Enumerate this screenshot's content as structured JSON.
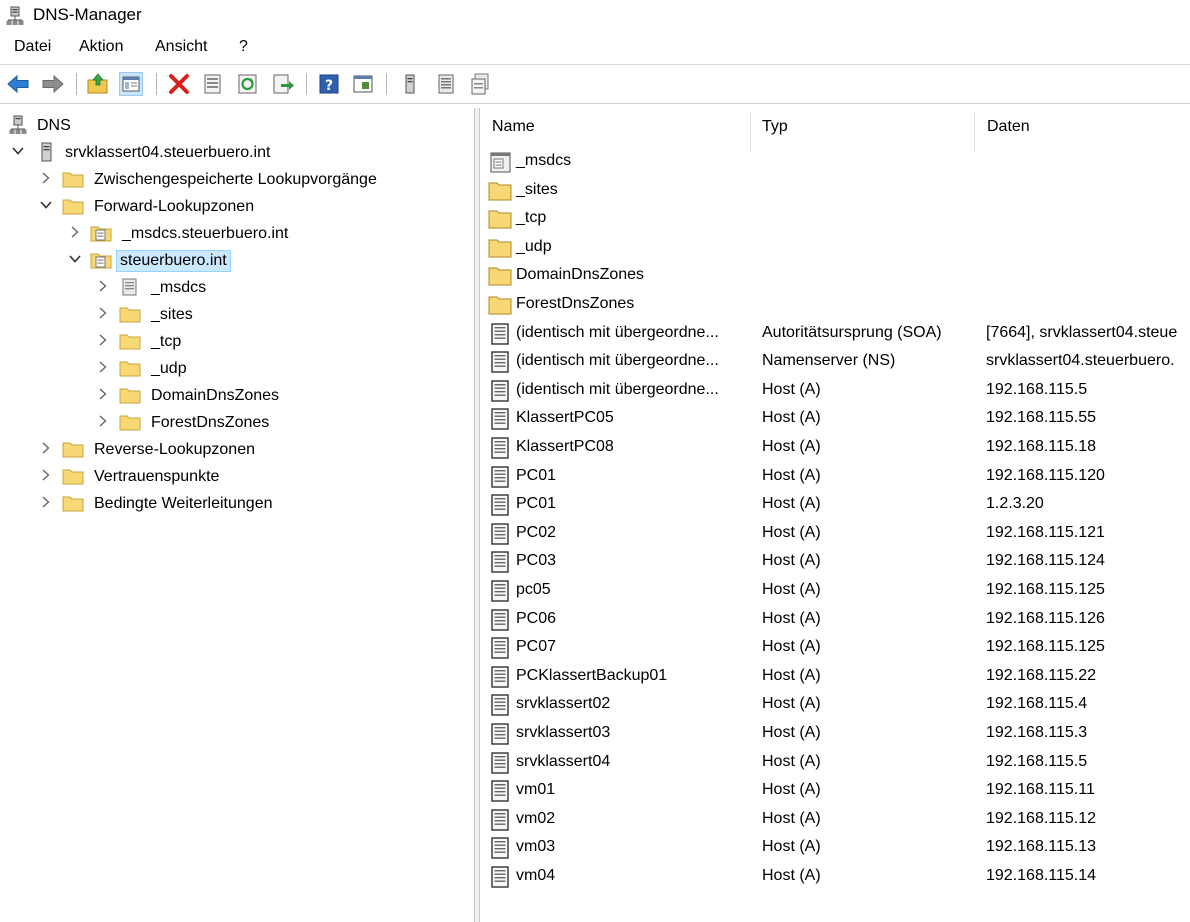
{
  "window": {
    "title": "DNS-Manager"
  },
  "menu": [
    "Datei",
    "Aktion",
    "Ansicht",
    "?"
  ],
  "toolbar": [
    "back-icon",
    "forward-icon",
    "up-folder-icon",
    "show-hide-tree-icon",
    "delete-icon",
    "properties-icon",
    "refresh-icon",
    "export-icon",
    "help-icon",
    "console-icon",
    "server-icon",
    "zone-icon",
    "zone-settings-icon"
  ],
  "tree": {
    "root": "DNS",
    "server": "srvklassert04.steuerbuero.int",
    "items": [
      "Zwischengespeicherte Lookupvorgänge",
      "Forward-Lookupzonen",
      "_msdcs.steuerbuero.int",
      "steuerbuero.int",
      "_msdcs",
      "_sites",
      "_tcp",
      "_udp",
      "DomainDnsZones",
      "ForestDnsZones",
      "Reverse-Lookupzonen",
      "Vertrauenspunkte",
      "Bedingte Weiterleitungen"
    ]
  },
  "list": {
    "columns": [
      "Name",
      "Typ",
      "Daten"
    ],
    "rows": [
      {
        "name": "_msdcs",
        "type": "",
        "data": "",
        "icon": "zone-icon"
      },
      {
        "name": "_sites",
        "type": "",
        "data": "",
        "icon": "folder-icon"
      },
      {
        "name": "_tcp",
        "type": "",
        "data": "",
        "icon": "folder-icon"
      },
      {
        "name": "_udp",
        "type": "",
        "data": "",
        "icon": "folder-icon"
      },
      {
        "name": "DomainDnsZones",
        "type": "",
        "data": "",
        "icon": "folder-icon"
      },
      {
        "name": "ForestDnsZones",
        "type": "",
        "data": "",
        "icon": "folder-icon"
      },
      {
        "name": "(identisch mit übergeordne...",
        "type": "Autoritätsursprung (SOA)",
        "data": "[7664], srvklassert04.steue",
        "icon": "record-icon"
      },
      {
        "name": "(identisch mit übergeordne...",
        "type": "Namenserver (NS)",
        "data": "srvklassert04.steuerbuero.",
        "icon": "record-icon"
      },
      {
        "name": "(identisch mit übergeordne...",
        "type": "Host (A)",
        "data": "192.168.115.5",
        "icon": "record-icon"
      },
      {
        "name": "KlassertPC05",
        "type": "Host (A)",
        "data": "192.168.115.55",
        "icon": "record-icon"
      },
      {
        "name": "KlassertPC08",
        "type": "Host (A)",
        "data": "192.168.115.18",
        "icon": "record-icon"
      },
      {
        "name": "PC01",
        "type": "Host (A)",
        "data": "192.168.115.120",
        "icon": "record-icon"
      },
      {
        "name": "PC01",
        "type": "Host (A)",
        "data": "1.2.3.20",
        "icon": "record-icon"
      },
      {
        "name": "PC02",
        "type": "Host (A)",
        "data": "192.168.115.121",
        "icon": "record-icon"
      },
      {
        "name": "PC03",
        "type": "Host (A)",
        "data": "192.168.115.124",
        "icon": "record-icon"
      },
      {
        "name": "pc05",
        "type": "Host (A)",
        "data": "192.168.115.125",
        "icon": "record-icon"
      },
      {
        "name": "PC06",
        "type": "Host (A)",
        "data": "192.168.115.126",
        "icon": "record-icon"
      },
      {
        "name": "PC07",
        "type": "Host (A)",
        "data": "192.168.115.125",
        "icon": "record-icon"
      },
      {
        "name": "PCKlassertBackup01",
        "type": "Host (A)",
        "data": "192.168.115.22",
        "icon": "record-icon"
      },
      {
        "name": "srvklassert02",
        "type": "Host (A)",
        "data": "192.168.115.4",
        "icon": "record-icon"
      },
      {
        "name": "srvklassert03",
        "type": "Host (A)",
        "data": "192.168.115.3",
        "icon": "record-icon"
      },
      {
        "name": "srvklassert04",
        "type": "Host (A)",
        "data": "192.168.115.5",
        "icon": "record-icon"
      },
      {
        "name": "vm01",
        "type": "Host (A)",
        "data": "192.168.115.11",
        "icon": "record-icon"
      },
      {
        "name": "vm02",
        "type": "Host (A)",
        "data": "192.168.115.12",
        "icon": "record-icon"
      },
      {
        "name": "vm03",
        "type": "Host (A)",
        "data": "192.168.115.13",
        "icon": "record-icon"
      },
      {
        "name": "vm04",
        "type": "Host (A)",
        "data": "192.168.115.14",
        "icon": "record-icon"
      }
    ]
  },
  "colors": {
    "selection": "#cce8ff",
    "folder": "#f8d775",
    "toolbar_active": "#cce4f7"
  }
}
